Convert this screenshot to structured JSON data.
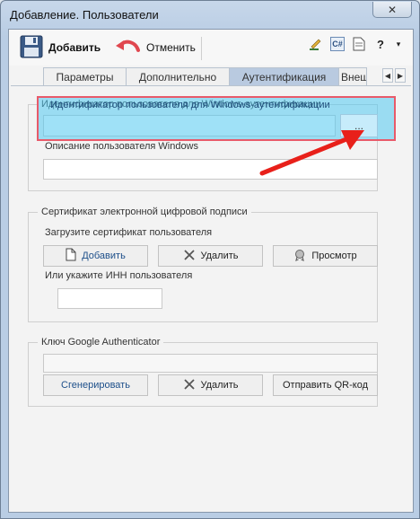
{
  "window": {
    "title": "Добавление. Пользователи",
    "close_label": "✕"
  },
  "toolbar": {
    "add_label": "Добавить",
    "cancel_label": "Отменить",
    "right_icons": [
      "edit-icon",
      "csharp-icon",
      "document-icon",
      "help-icon"
    ],
    "csharp_text": "C#",
    "help_text": "?",
    "dropdown_text": "▾"
  },
  "tabs": [
    {
      "label": "Параметры",
      "active": false
    },
    {
      "label": "Дополнительно",
      "active": false
    },
    {
      "label": "Аутентификация",
      "active": true
    },
    {
      "label": "Внешн",
      "active": false
    }
  ],
  "tab_scroll": {
    "left": "◀",
    "right": "▶"
  },
  "windows_auth": {
    "title": "Идентификатор пользователя для Windows-аутентификации",
    "id_value": "",
    "browse_label": "...",
    "description_label": "Описание пользователя Windows",
    "description_value": ""
  },
  "certificate": {
    "title": "Сертификат электронной цифровой подписи",
    "load_label": "Загрузите сертификат пользователя",
    "add_label": "Добавить",
    "delete_label": "Удалить",
    "view_label": "Просмотр",
    "inn_label": "Или укажите ИНН пользователя",
    "inn_value": ""
  },
  "google_auth": {
    "title": "Ключ Google Authenticator",
    "key_value": "",
    "generate_label": "Сгенерировать",
    "delete_label": "Удалить",
    "send_qr_label": "Отправить QR-код"
  },
  "colors": {
    "highlight": "#50c8f0",
    "highlight_border": "#e85a6a",
    "arrow": "#e8201a",
    "active_tab": "#b9cae0"
  }
}
